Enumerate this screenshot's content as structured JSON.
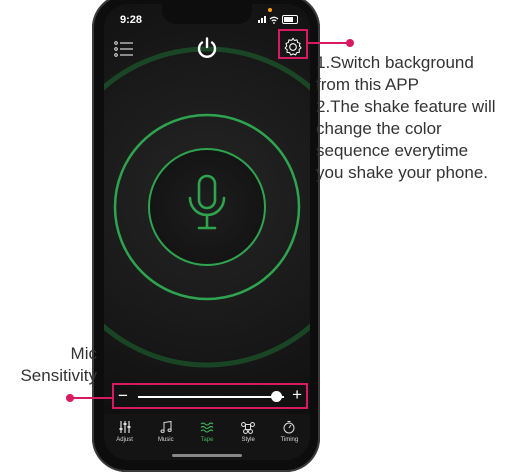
{
  "status": {
    "time": "9:28"
  },
  "topbar": {
    "menu_icon": "list-icon",
    "power_icon": "power-icon",
    "settings_icon": "gear-icon"
  },
  "mic": {
    "icon": "microphone-icon",
    "accent": "#2ea44f"
  },
  "slider": {
    "minus": "−",
    "plus": "+",
    "value": 0.95
  },
  "tabs": [
    {
      "label": "Adjust",
      "icon": "sliders-icon",
      "active": false
    },
    {
      "label": "Music",
      "icon": "music-note-icon",
      "active": false
    },
    {
      "label": "Tape",
      "icon": "wave-icon",
      "active": true
    },
    {
      "label": "Style",
      "icon": "command-icon",
      "active": false
    },
    {
      "label": "Timing",
      "icon": "timer-icon",
      "active": false
    }
  ],
  "annotation": {
    "lines": [
      "1.Switch background",
      "from this APP",
      "2.The shake feature will",
      "change the color",
      "sequence everytime",
      "you shake your phone."
    ]
  },
  "mic_label": {
    "line1": "Mic",
    "line2": "Sensitivity"
  },
  "colors": {
    "highlight": "#d81b60",
    "active_tab": "#3fb559",
    "background": "#161616"
  }
}
